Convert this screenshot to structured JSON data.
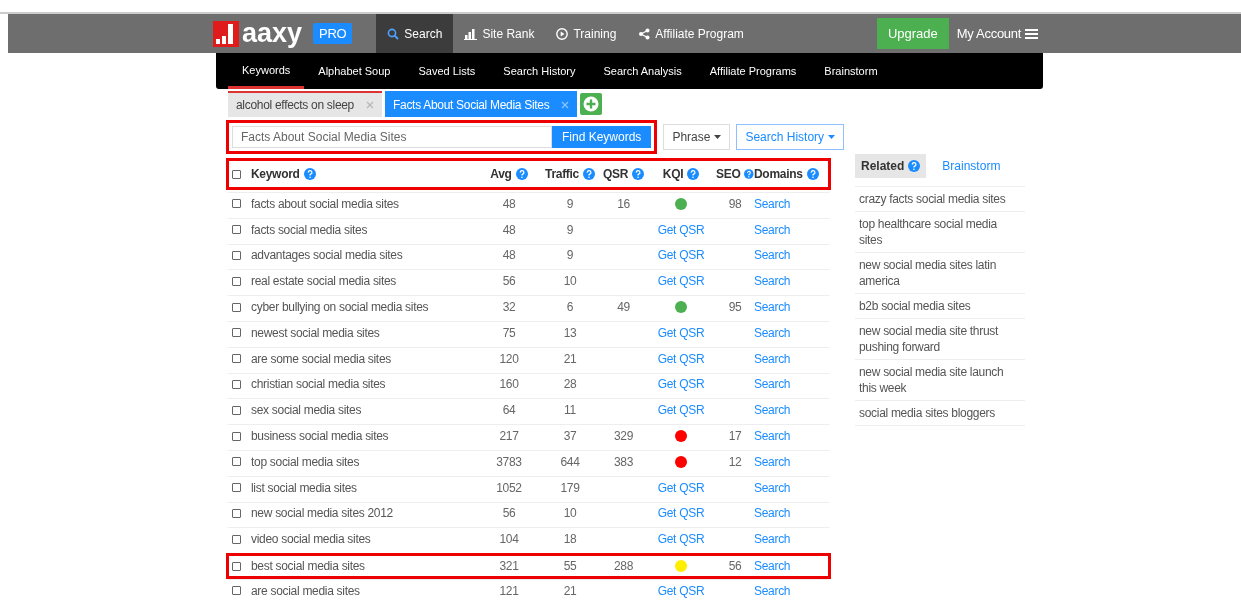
{
  "top_nav": {
    "logo": "aaxy",
    "badge": "PRO",
    "items": [
      {
        "label": "Search",
        "selected": true
      },
      {
        "label": "Site Rank",
        "selected": false
      },
      {
        "label": "Training",
        "selected": false
      },
      {
        "label": "Affiliate Program",
        "selected": false
      }
    ],
    "upgrade": "Upgrade",
    "account": "My Account"
  },
  "sub_nav": [
    {
      "label": "Keywords",
      "selected": true
    },
    {
      "label": "Alphabet Soup",
      "selected": false
    },
    {
      "label": "Saved Lists",
      "selected": false
    },
    {
      "label": "Search History",
      "selected": false
    },
    {
      "label": "Search Analysis",
      "selected": false
    },
    {
      "label": "Affiliate Programs",
      "selected": false
    },
    {
      "label": "Brainstorm",
      "selected": false
    }
  ],
  "search_tabs": [
    {
      "label": "alcohol effects on sleep",
      "selected": false
    },
    {
      "label": "Facts About Social Media Sites",
      "selected": true
    }
  ],
  "search": {
    "value": "Facts About Social Media Sites",
    "button": "Find Keywords",
    "highlighted": true,
    "match": "Phrase",
    "history": "Search History"
  },
  "table": {
    "highlighted_header": true,
    "columns": [
      "Keyword",
      "Avg",
      "Traffic",
      "QSR",
      "KQI",
      "SEO",
      "Domains"
    ],
    "rows": [
      {
        "keyword": "facts about social media sites",
        "avg": "48",
        "traffic": "9",
        "qsr": "16",
        "kqi": {
          "kind": "dot",
          "color": "#4caf50"
        },
        "seo": "98",
        "domains": "Search",
        "highlighted": false
      },
      {
        "keyword": "facts social media sites",
        "avg": "48",
        "traffic": "9",
        "kqi": {
          "kind": "link",
          "label": "Get QSR"
        },
        "domains": "Search",
        "highlighted": false
      },
      {
        "keyword": "advantages social media sites",
        "avg": "48",
        "traffic": "9",
        "kqi": {
          "kind": "link",
          "label": "Get QSR"
        },
        "domains": "Search",
        "highlighted": false
      },
      {
        "keyword": "real estate social media sites",
        "avg": "56",
        "traffic": "10",
        "kqi": {
          "kind": "link",
          "label": "Get QSR"
        },
        "domains": "Search",
        "highlighted": false
      },
      {
        "keyword": "cyber bullying on social media sites",
        "avg": "32",
        "traffic": "6",
        "qsr": "49",
        "kqi": {
          "kind": "dot",
          "color": "#4caf50"
        },
        "seo": "95",
        "domains": "Search",
        "highlighted": false
      },
      {
        "keyword": "newest social media sites",
        "avg": "75",
        "traffic": "13",
        "kqi": {
          "kind": "link",
          "label": "Get QSR"
        },
        "domains": "Search",
        "highlighted": false
      },
      {
        "keyword": "are some social media sites",
        "avg": "120",
        "traffic": "21",
        "kqi": {
          "kind": "link",
          "label": "Get QSR"
        },
        "domains": "Search",
        "highlighted": false
      },
      {
        "keyword": "christian social media sites",
        "avg": "160",
        "traffic": "28",
        "kqi": {
          "kind": "link",
          "label": "Get QSR"
        },
        "domains": "Search",
        "highlighted": false
      },
      {
        "keyword": "sex social media sites",
        "avg": "64",
        "traffic": "11",
        "kqi": {
          "kind": "link",
          "label": "Get QSR"
        },
        "domains": "Search",
        "highlighted": false
      },
      {
        "keyword": "business social media sites",
        "avg": "217",
        "traffic": "37",
        "qsr": "329",
        "kqi": {
          "kind": "dot",
          "color": "#ff0000"
        },
        "seo": "17",
        "domains": "Search",
        "highlighted": false
      },
      {
        "keyword": "top social media sites",
        "avg": "3783",
        "traffic": "644",
        "qsr": "383",
        "kqi": {
          "kind": "dot",
          "color": "#ff0000"
        },
        "seo": "12",
        "domains": "Search",
        "highlighted": false
      },
      {
        "keyword": "list social media sites",
        "avg": "1052",
        "traffic": "179",
        "kqi": {
          "kind": "link",
          "label": "Get QSR"
        },
        "domains": "Search",
        "highlighted": false
      },
      {
        "keyword": "new social media sites 2012",
        "avg": "56",
        "traffic": "10",
        "kqi": {
          "kind": "link",
          "label": "Get QSR"
        },
        "domains": "Search",
        "highlighted": false
      },
      {
        "keyword": "video social media sites",
        "avg": "104",
        "traffic": "18",
        "kqi": {
          "kind": "link",
          "label": "Get QSR"
        },
        "domains": "Search",
        "highlighted": false
      },
      {
        "keyword": "best social media sites",
        "avg": "321",
        "traffic": "55",
        "qsr": "288",
        "kqi": {
          "kind": "dot",
          "color": "#ffee00"
        },
        "seo": "56",
        "domains": "Search",
        "highlighted": true
      },
      {
        "keyword": "are social media sites",
        "avg": "121",
        "traffic": "21",
        "kqi": {
          "kind": "link",
          "label": "Get QSR"
        },
        "domains": "Search",
        "highlighted": false
      }
    ]
  },
  "related": {
    "tabs": [
      {
        "label": "Related",
        "selected": true
      },
      {
        "label": "Brainstorm",
        "selected": false
      }
    ],
    "items": [
      "crazy facts social media sites",
      "top healthcare social media sites",
      "new social media sites latin america",
      "b2b social media sites",
      "new social media site thrust pushing forward",
      "new social media site launch this week",
      "social media sites bloggers"
    ]
  }
}
